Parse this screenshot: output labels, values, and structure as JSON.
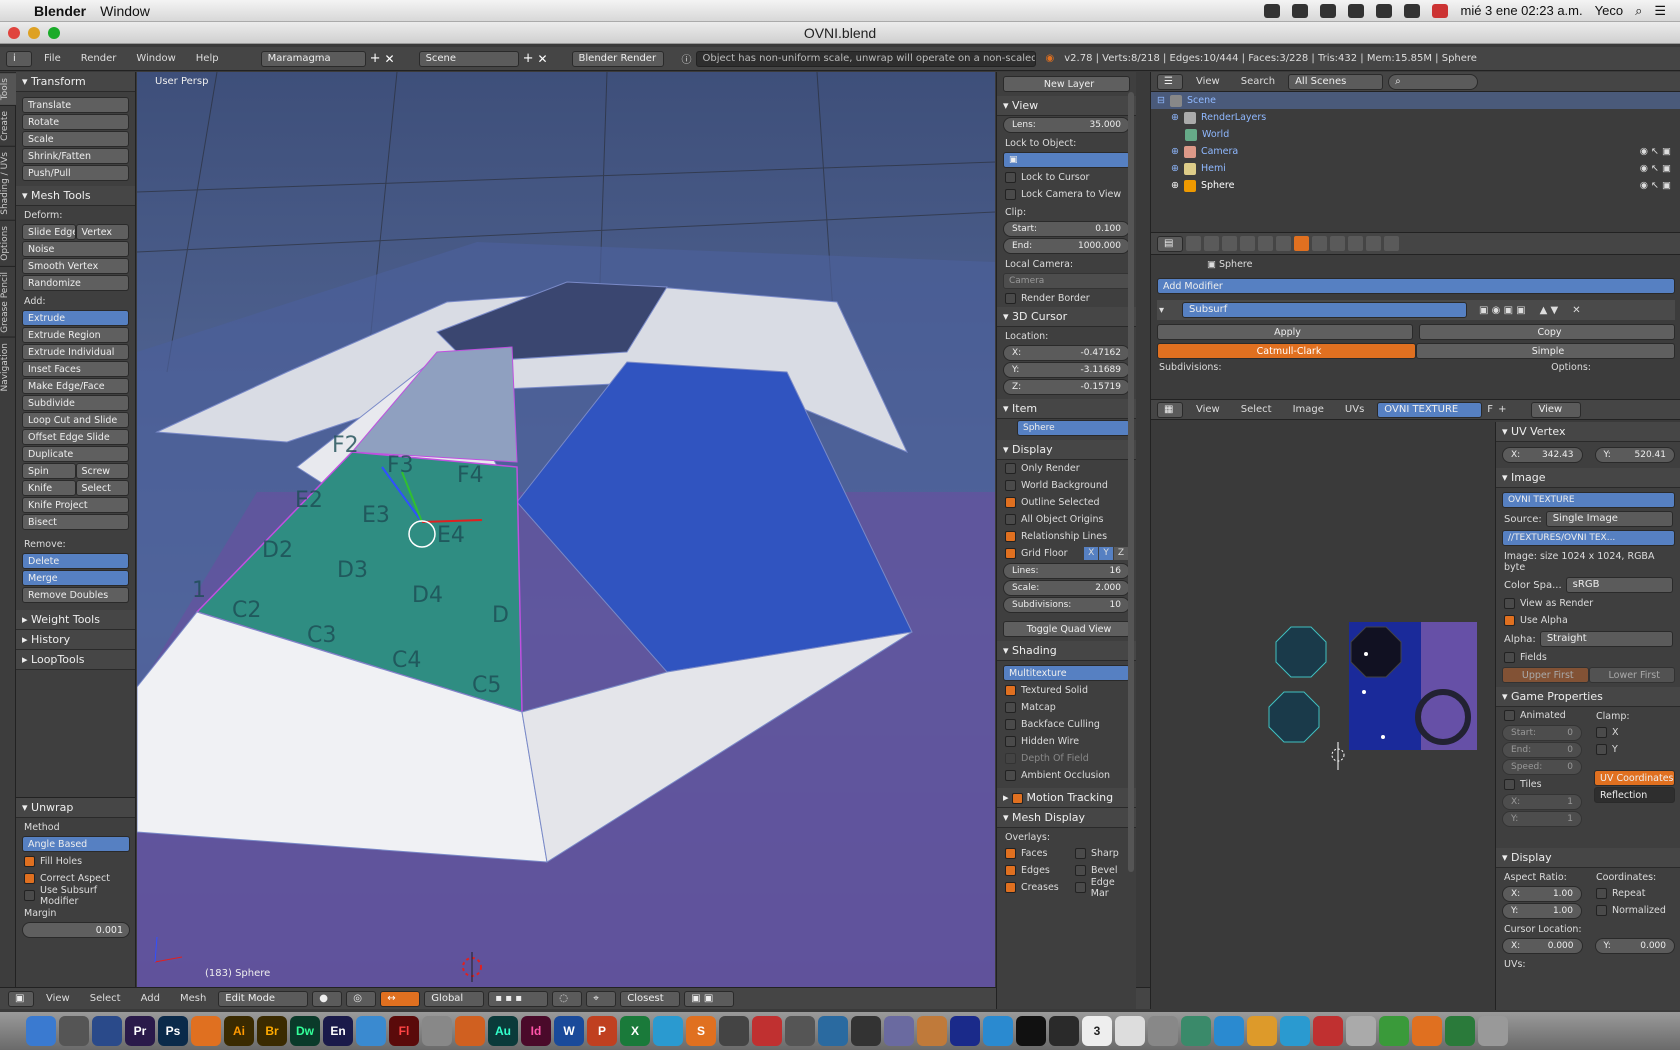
{
  "mac_menu": {
    "app": "Blender",
    "window": "Window",
    "datetime": "mié 3 ene  02:23 a.m.",
    "user": "Yeco"
  },
  "window_title": "OVNI.blend",
  "info_header": {
    "menus": [
      "File",
      "Render",
      "Window",
      "Help"
    ],
    "layout": "Maramagma",
    "scene": "Scene",
    "engine": "Blender Render",
    "warning": "Object has non-uniform scale, unwrap will operate on a non-scaled version of the mesh",
    "stats": "v2.78 | Verts:8/218 | Edges:10/444 | Faces:3/228 | Tris:432 | Mem:15.85M | Sphere"
  },
  "tool_tabs": [
    "Tools",
    "Create",
    "Shading / UVs",
    "Options",
    "Grease Pencil",
    "Navigation"
  ],
  "toolshelf": {
    "transform_title": "Transform",
    "transform": [
      "Translate",
      "Rotate",
      "Scale",
      "Shrink/Fatten",
      "Push/Pull"
    ],
    "mesh_tools_title": "Mesh Tools",
    "deform_label": "Deform:",
    "slide_edge": "Slide Edge",
    "vertex": "Vertex",
    "deform": [
      "Noise",
      "Smooth Vertex",
      "Randomize"
    ],
    "add_label": "Add:",
    "extrude": "Extrude",
    "add": [
      "Extrude Region",
      "Extrude Individual",
      "Inset Faces",
      "Make Edge/Face",
      "Subdivide",
      "Loop Cut and Slide",
      "Offset Edge Slide",
      "Duplicate"
    ],
    "spin": "Spin",
    "screw": "Screw",
    "knife": "Knife",
    "select": "Select",
    "knife_project": "Knife Project",
    "bisect": "Bisect",
    "remove_label": "Remove:",
    "delete": "Delete",
    "merge": "Merge",
    "remove_doubles": "Remove Doubles",
    "collapsed": [
      "Weight Tools",
      "History",
      "LoopTools"
    ],
    "unwrap_title": "Unwrap",
    "method_label": "Method",
    "method": "Angle Based",
    "fill_holes": "Fill Holes",
    "correct_aspect": "Correct Aspect",
    "use_subsurf": "Use Subsurf Modifier",
    "margin_label": "Margin",
    "margin": "0.001"
  },
  "viewport": {
    "view_name": "User Persp",
    "object_info": "(183) Sphere",
    "uv_labels": [
      "F2",
      "F3",
      "F4",
      "E2",
      "E3",
      "E4",
      "D2",
      "D3",
      "D4",
      "D",
      "C2",
      "C3",
      "C4",
      "C5",
      "1"
    ]
  },
  "viewport_header": {
    "menus": [
      "View",
      "Select",
      "Add",
      "Mesh"
    ],
    "mode": "Edit Mode",
    "orientation": "Global",
    "snap": "Closest"
  },
  "npanel": {
    "new_layer": "New Layer",
    "view_title": "View",
    "lens_label": "Lens:",
    "lens": "35.000",
    "lock_to_object": "Lock to Object:",
    "lock_to_cursor": "Lock to Cursor",
    "lock_camera": "Lock Camera to View",
    "clip_label": "Clip:",
    "clip_start_label": "Start:",
    "clip_start": "0.100",
    "clip_end_label": "End:",
    "clip_end": "1000.000",
    "local_camera_label": "Local Camera:",
    "local_camera": "Camera",
    "render_border": "Render Border",
    "cursor_title": "3D Cursor",
    "location_label": "Location:",
    "cx_label": "X:",
    "cx": "-0.47162",
    "cy_label": "Y:",
    "cy": "-3.11689",
    "cz_label": "Z:",
    "cz": "-0.15719",
    "item_title": "Item",
    "item_name": "Sphere",
    "display_title": "Display",
    "only_render": "Only Render",
    "world_bg": "World Background",
    "outline_selected": "Outline Selected",
    "all_origins": "All Object Origins",
    "relationship_lines": "Relationship Lines",
    "grid_floor": "Grid Floor",
    "gx": "X",
    "gy": "Y",
    "gz": "Z",
    "lines_label": "Lines:",
    "lines": "16",
    "scale_label": "Scale:",
    "scale": "2.000",
    "subdiv_label": "Subdivisions:",
    "subdiv": "10",
    "toggle_quad": "Toggle Quad View",
    "shading_title": "Shading",
    "shading_mode": "Multitexture",
    "textured_solid": "Textured Solid",
    "matcap": "Matcap",
    "backface": "Backface Culling",
    "hidden_wire": "Hidden Wire",
    "dof": "Depth Of Field",
    "ao": "Ambient Occlusion",
    "motion_tracking": "Motion Tracking",
    "mesh_display_title": "Mesh Display",
    "overlays_label": "Overlays:",
    "faces": "Faces",
    "sharp": "Sharp",
    "edges": "Edges",
    "bevel": "Bevel",
    "creases": "Creases",
    "edge_mar": "Edge Mar"
  },
  "outliner": {
    "menus": [
      "View",
      "Search"
    ],
    "filter": "All Scenes",
    "items": [
      {
        "label": "Scene",
        "indent": 0
      },
      {
        "label": "RenderLayers",
        "indent": 1
      },
      {
        "label": "World",
        "indent": 1
      },
      {
        "label": "Camera",
        "indent": 1
      },
      {
        "label": "Hemi",
        "indent": 1
      },
      {
        "label": "Sphere",
        "indent": 1
      }
    ]
  },
  "properties": {
    "object": "Sphere",
    "add_modifier": "Add Modifier",
    "modifier_name": "Subsurf",
    "apply": "Apply",
    "copy": "Copy",
    "catmull": "Catmull-Clark",
    "simple": "Simple",
    "subdivisions": "Subdivisions:",
    "options": "Options:"
  },
  "uv_editor": {
    "menus": [
      "View",
      "Select",
      "Image",
      "UVs"
    ],
    "image_name": "OVNI TEXTURE",
    "f_label": "F",
    "view": "View",
    "uv_vertex_title": "UV Vertex",
    "ux_label": "X:",
    "ux": "342.43",
    "uy_label": "Y:",
    "uy": "520.41",
    "image_title": "Image",
    "source_label": "Source:",
    "source": "Single Image",
    "path": "//TEXTURES/OVNI TEX...",
    "image_size": "Image: size 1024 x 1024, RGBA byte",
    "colorspace_label": "Color Spa...",
    "colorspace": "sRGB",
    "view_as_render": "View as Render",
    "use_alpha": "Use Alpha",
    "alpha_label": "Alpha:",
    "alpha": "Straight",
    "fields": "Fields",
    "upper_first": "Upper First",
    "lower_first": "Lower First",
    "game_title": "Game Properties",
    "animated": "Animated",
    "clamp": "Clamp:",
    "start_label": "Start:",
    "start": "0",
    "end_label": "End:",
    "end": "0",
    "speed_label": "Speed:",
    "speed": "0",
    "clamp_x": "X",
    "clamp_y": "Y",
    "tiles": "Tiles",
    "tx_label": "X:",
    "tx": "1",
    "ty_label": "Y:",
    "ty": "1",
    "uv_coords": "UV Coordinates",
    "reflection": "Reflection",
    "display_title": "Display",
    "aspect_label": "Aspect Ratio:",
    "coords_label": "Coordinates:",
    "ax_label": "X:",
    "ax": "1.00",
    "ay_label": "Y:",
    "ay": "1.00",
    "repeat": "Repeat",
    "normalized": "Normalized",
    "cursor_loc": "Cursor Location:",
    "clx_label": "X:",
    "clx": "0.000",
    "cly_label": "Y:",
    "cly": "0.000",
    "uvs_label": "UVs:"
  },
  "dock_labels": [
    "Pr",
    "Ps",
    "Ai",
    "Br",
    "Dw",
    "En",
    "Fl",
    "Au",
    "Id",
    "W",
    "P",
    "X",
    "S",
    "3"
  ],
  "colors": {
    "accent": "#e07020",
    "select_blue": "#5680c2",
    "uv_face": "#1a2a9a"
  }
}
